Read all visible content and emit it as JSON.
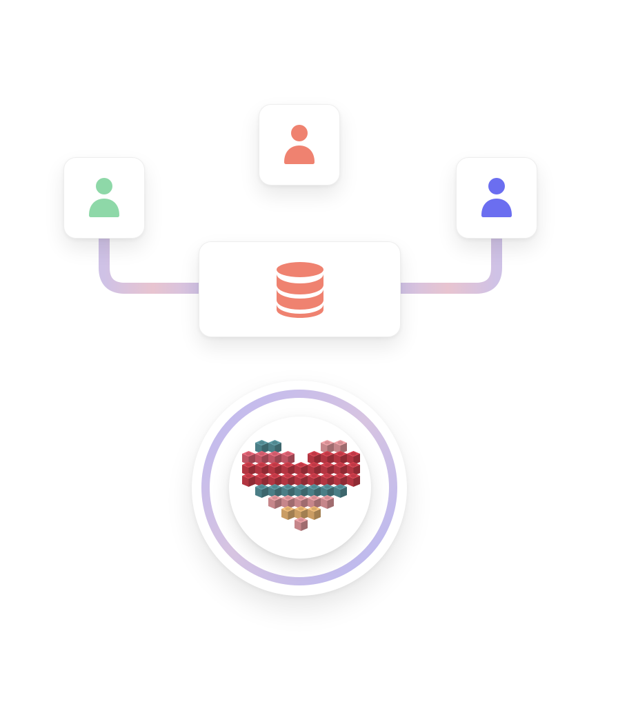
{
  "nodes": {
    "users": [
      {
        "id": "user-left",
        "icon": "user-icon",
        "color": "#8ed8a8"
      },
      {
        "id": "user-center",
        "icon": "user-icon",
        "color": "#ef8270"
      },
      {
        "id": "user-right",
        "icon": "user-icon",
        "color": "#6b6ef0"
      }
    ],
    "database": {
      "icon": "database-icon",
      "color": "#ef8270"
    },
    "destination": {
      "icon": "brick-heart-logo",
      "ring_colors": [
        "#b9b6f2",
        "#d8c3df"
      ]
    }
  },
  "connectors": {
    "colors": [
      "#b8b6ef",
      "#e6c2d0"
    ]
  },
  "logo_palette": [
    "#d9414f",
    "#e9677a",
    "#f2a3a8",
    "#f6c07a",
    "#3e7f8b",
    "#5c9aa4"
  ]
}
